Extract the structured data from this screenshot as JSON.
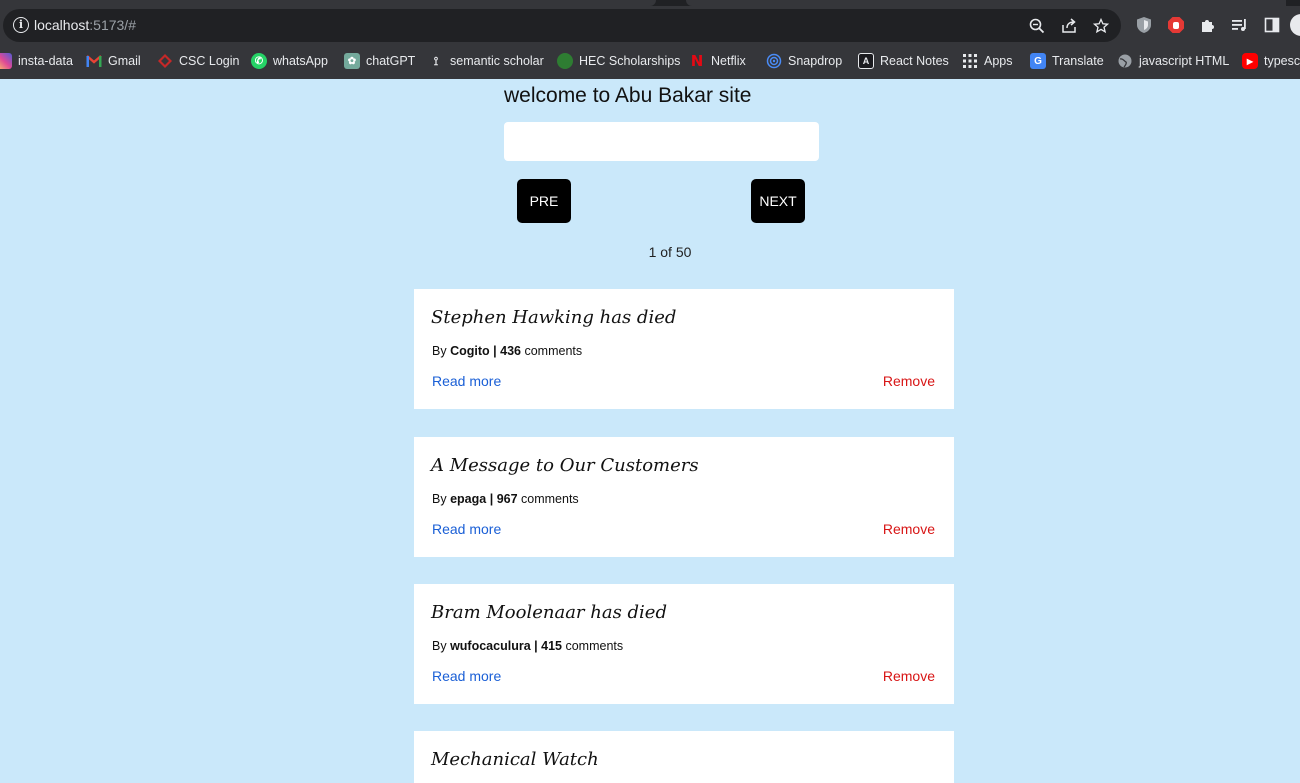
{
  "browser": {
    "url_host": "localhost",
    "url_rest": ":5173/#",
    "bookmarks": [
      {
        "label": "insta-data",
        "icon": "instagram-icon",
        "color": "#e1306c"
      },
      {
        "label": "Gmail",
        "icon": "gmail-icon",
        "color": "#ea4335"
      },
      {
        "label": "CSC Login",
        "icon": "csc-icon",
        "color": "#c62828"
      },
      {
        "label": "whatsApp",
        "icon": "whatsapp-icon",
        "color": "#25d366"
      },
      {
        "label": "chatGPT",
        "icon": "chatgpt-icon",
        "color": "#74aa9c"
      },
      {
        "label": "semantic scholar",
        "icon": "semantic-scholar-icon",
        "color": "#e8eaed"
      },
      {
        "label": "HEC Scholarships",
        "icon": "hec-icon",
        "color": "#2e7d32"
      },
      {
        "label": "Netflix",
        "icon": "netflix-icon",
        "color": "#e50914"
      },
      {
        "label": "Snapdrop",
        "icon": "snapdrop-icon",
        "color": "#4a8cf7"
      },
      {
        "label": "React Notes",
        "icon": "react-notes-icon",
        "color": "#e8eaed"
      },
      {
        "label": "Apps",
        "icon": "apps-grid-icon",
        "color": "#e8eaed"
      },
      {
        "label": "Translate",
        "icon": "translate-icon",
        "color": "#4285f4"
      },
      {
        "label": "javascript HTML",
        "icon": "globe-icon",
        "color": "#bdc1c6"
      },
      {
        "label": "typesc",
        "icon": "youtube-icon",
        "color": "#ff0000"
      }
    ]
  },
  "page": {
    "title": "welcome to Abu Bakar site",
    "search_value": "",
    "pre_label": "PRE",
    "next_label": "NEXT",
    "pagination": "1 of 50"
  },
  "stories": [
    {
      "title": "Stephen Hawking has died",
      "by": "By",
      "author": "Cogito",
      "sep": "|",
      "comments": "436",
      "comments_label": "comments",
      "read_more": "Read more",
      "remove": "Remove"
    },
    {
      "title": "A Message to Our Customers",
      "by": "By",
      "author": "epaga",
      "sep": "|",
      "comments": "967",
      "comments_label": "comments",
      "read_more": "Read more",
      "remove": "Remove"
    },
    {
      "title": "Bram Moolenaar has died",
      "by": "By",
      "author": "wufocaculura",
      "sep": "|",
      "comments": "415",
      "comments_label": "comments",
      "read_more": "Read more",
      "remove": "Remove"
    },
    {
      "title": "Mechanical Watch",
      "by": "",
      "author": "",
      "sep": "",
      "comments": "",
      "comments_label": "",
      "read_more": "",
      "remove": ""
    }
  ]
}
